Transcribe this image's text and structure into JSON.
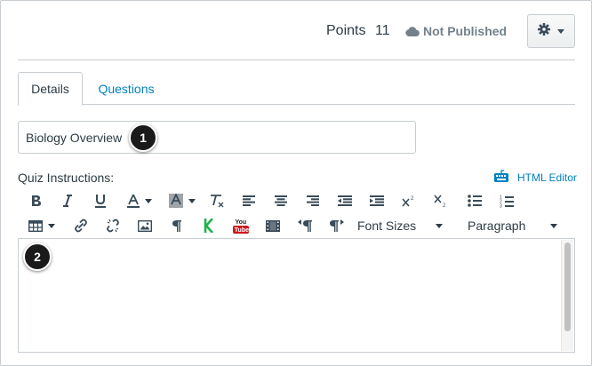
{
  "header": {
    "points_label": "Points",
    "points_value": "11",
    "publish_status": "Not Published",
    "settings_icon": "gear-icon",
    "cloud_icon": "cloud-icon"
  },
  "tabs": [
    {
      "label": "Details",
      "active": true
    },
    {
      "label": "Questions",
      "active": false
    }
  ],
  "title_input": {
    "value": "Biology Overview"
  },
  "callouts": {
    "one": "1",
    "two": "2"
  },
  "instructions": {
    "label": "Quiz Instructions:",
    "html_editor_label": "HTML Editor",
    "html_editor_icon": "keyboard-icon"
  },
  "toolbar": {
    "row1": [
      "bold-icon",
      "italic-icon",
      "underline-icon",
      "text-color-icon",
      "background-color-icon",
      "clear-formatting-icon",
      "align-left-icon",
      "align-center-icon",
      "align-right-icon",
      "outdent-icon",
      "indent-icon",
      "superscript-icon",
      "subscript-icon",
      "bullet-list-icon",
      "numbered-list-icon"
    ],
    "row2": [
      "table-icon",
      "link-icon",
      "unlink-icon",
      "image-icon",
      "paragraph-icon",
      "kaltura-icon",
      "youtube-icon",
      "media-icon",
      "ltr-icon",
      "rtl-icon"
    ],
    "font_sizes_label": "Font Sizes",
    "paragraph_label": "Paragraph",
    "youtube_top": "You",
    "youtube_bottom": "Tube",
    "kaltura_letter": "K"
  },
  "colors": {
    "link": "#0081bd",
    "text": "#2d3b45",
    "muted": "#73818c",
    "border": "#c7cdd1",
    "kaltura": "#20b24b",
    "youtube": "#cc181e"
  }
}
